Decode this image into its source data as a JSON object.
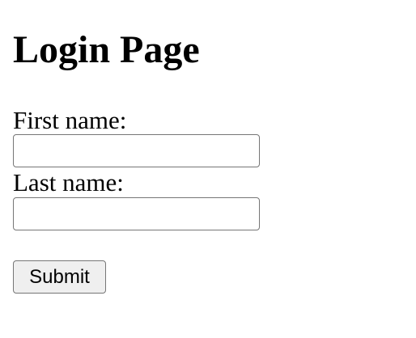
{
  "page": {
    "title": "Login Page"
  },
  "form": {
    "first_name": {
      "label": "First name:",
      "value": "",
      "placeholder": ""
    },
    "last_name": {
      "label": "Last name:",
      "value": "",
      "placeholder": ""
    },
    "submit_label": "Submit"
  }
}
